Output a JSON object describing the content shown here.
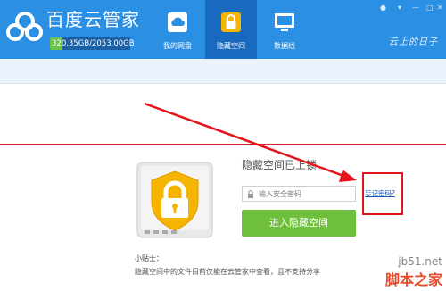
{
  "app": {
    "title": "百度云管家",
    "storage_text": "320.35GB/2053.00GB",
    "storage_used_fraction": 0.156,
    "slogan": "云上的日子"
  },
  "tabs": [
    {
      "label": "我的网盘",
      "icon": "cloud-drive-icon",
      "active": false
    },
    {
      "label": "隐藏空间",
      "icon": "lock-folder-icon",
      "active": true
    },
    {
      "label": "数据线",
      "icon": "monitor-icon",
      "active": false
    }
  ],
  "locked_panel": {
    "title": "隐藏空间已上锁",
    "password_placeholder": "输入安全密码",
    "forgot_link": "忘记密码?",
    "enter_button": "进入隐藏空间",
    "tips_title": "小贴士：",
    "tips_text": "隐藏空间中的文件目前仅能在云管家中查看，且不支持分享"
  },
  "watermark": {
    "url": "jb51.net",
    "name": "脚本之家"
  },
  "colors": {
    "header": "#2b8fe3",
    "active_tab": "#1869c0",
    "button": "#6ebf3b",
    "highlight": "#e3151a",
    "link": "#1a55c0"
  }
}
